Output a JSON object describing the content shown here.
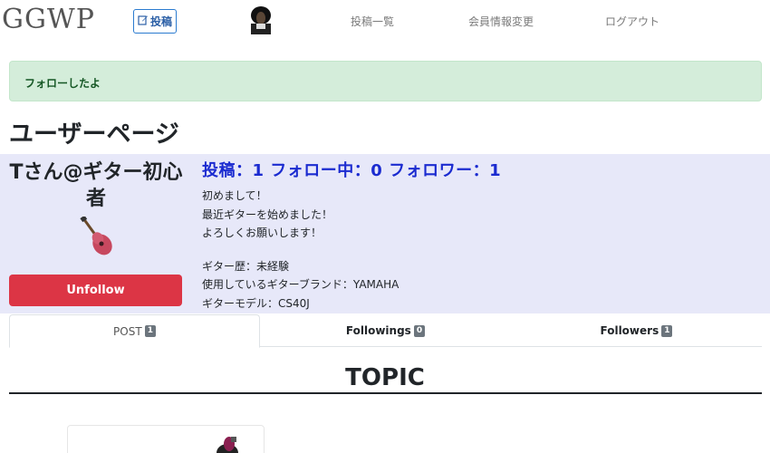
{
  "navbar": {
    "brand": "GGWP",
    "post_button_label": "投稿",
    "links": [
      "投稿一覧",
      "会員情報変更",
      "ログアウト"
    ]
  },
  "alert": {
    "message": "フォローしたよ"
  },
  "page_title": "ユーザーページ",
  "profile": {
    "name": "Tさん@ギター初心者",
    "stats": "投稿：1 フォロー中：0 フォロワー：1",
    "bio_lines": [
      "初めまして！",
      "最近ギターを始めました！",
      "よろしくお願いします！"
    ],
    "details": [
      "ギター歴：未経験",
      "使用しているギターブランド：YAMAHA",
      "ギターモデル：CS40J"
    ],
    "unfollow_label": "Unfollow"
  },
  "tabs": [
    {
      "label": "POST",
      "count": "1"
    },
    {
      "label": "Followings",
      "count": "0"
    },
    {
      "label": "Followers",
      "count": "1"
    }
  ],
  "topic_heading": "TOPIC",
  "colors": {
    "alert_bg": "#d4edda",
    "profile_bg": "#e7e8f9",
    "unfollow_bg": "#dc3545",
    "stats_text": "#1b2bd0"
  }
}
